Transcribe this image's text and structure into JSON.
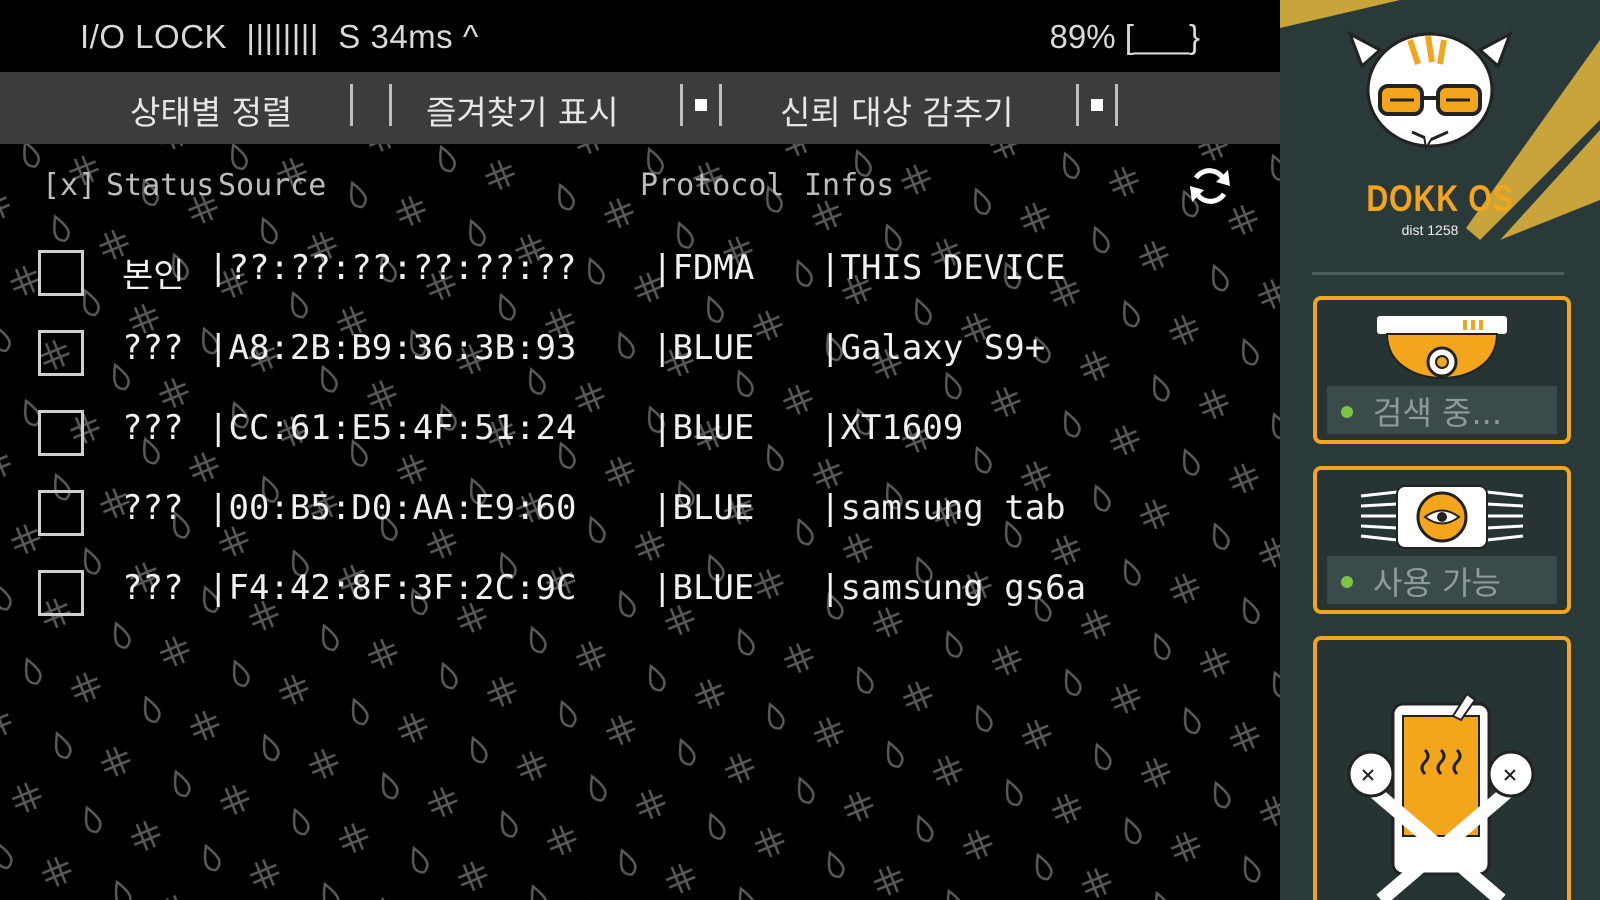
{
  "status_bar": {
    "left": "I/O LOCK  ||||||||  S 34ms ^",
    "right": "89% [___}"
  },
  "filters": [
    {
      "label": "상태별 정렬",
      "checked": false
    },
    {
      "label": "즐겨찾기 표시",
      "checked": true
    },
    {
      "label": "신뢰 대상 감추기",
      "checked": true
    }
  ],
  "columns": {
    "select": "[x]",
    "status": "Status",
    "source": "Source",
    "protocol": "Protocol",
    "infos": "Infos"
  },
  "rows": [
    {
      "status": "본인",
      "source": "|??:??:??:??:??:??",
      "protocol": "|FDMA",
      "info": "|THIS DEVICE"
    },
    {
      "status": "???",
      "source": "|A8:2B:B9:36:3B:93",
      "protocol": "|BLUE",
      "info": "|Galaxy S9+"
    },
    {
      "status": "???",
      "source": "|CC:61:E5:4F:51:24",
      "protocol": "|BLUE",
      "info": "|XT1609"
    },
    {
      "status": "???",
      "source": "|00:B5:D0:AA:E9:60",
      "protocol": "|BLUE",
      "info": "|samsung tab"
    },
    {
      "status": "???",
      "source": "|F4:42:8F:3F:2C:9C",
      "protocol": "|BLUE",
      "info": "|samsung gs6a"
    }
  ],
  "panel": {
    "brand": "DOKK OS",
    "dist": "dist 1258",
    "cards": [
      {
        "name": "scanner",
        "icon": "scanner-camera-icon",
        "status": "검색 중..."
      },
      {
        "name": "eye",
        "icon": "eye-device-icon",
        "status": "사용 가능"
      },
      {
        "name": "breaker",
        "icon": "broken-phone-bats-icon",
        "status": ""
      }
    ]
  },
  "colors": {
    "accent": "#f3a51b",
    "panel_bg": "#2a3a3a",
    "status_dot": "#7cc442",
    "filter_bar": "#3c3c3c"
  }
}
